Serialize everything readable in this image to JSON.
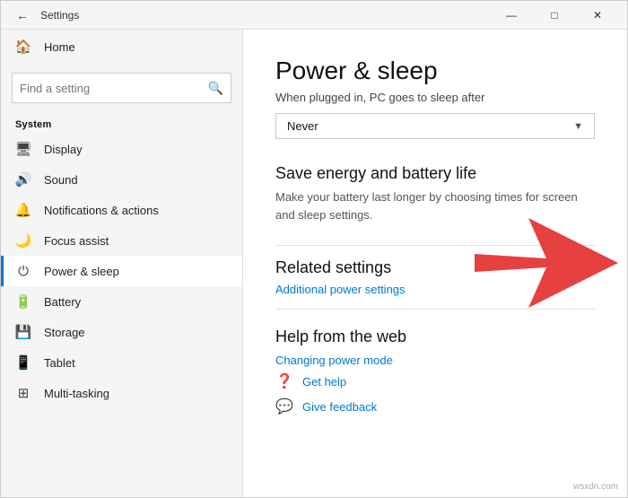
{
  "titlebar": {
    "title": "Settings",
    "back_label": "←",
    "minimize": "—",
    "maximize": "□",
    "close": "✕"
  },
  "sidebar": {
    "search_placeholder": "Find a setting",
    "home_label": "Home",
    "section_label": "System",
    "items": [
      {
        "id": "display",
        "label": "Display",
        "icon": "🖥"
      },
      {
        "id": "sound",
        "label": "Sound",
        "icon": "🔊"
      },
      {
        "id": "notifications",
        "label": "Notifications & actions",
        "icon": "🔔"
      },
      {
        "id": "focus",
        "label": "Focus assist",
        "icon": "🌙"
      },
      {
        "id": "power",
        "label": "Power & sleep",
        "icon": "⏻",
        "active": true
      },
      {
        "id": "battery",
        "label": "Battery",
        "icon": "🔋"
      },
      {
        "id": "storage",
        "label": "Storage",
        "icon": "💾"
      },
      {
        "id": "tablet",
        "label": "Tablet",
        "icon": "📱"
      },
      {
        "id": "multitasking",
        "label": "Multi-tasking",
        "icon": "⊞"
      }
    ]
  },
  "main": {
    "title": "Power & sleep",
    "sleep_label": "When plugged in, PC goes to sleep after",
    "dropdown_value": "Never",
    "save_energy_heading": "Save energy and battery life",
    "save_energy_text": "Make your battery last longer by choosing times for screen and sleep settings.",
    "related_heading": "Related settings",
    "additional_power_link": "Additional power settings",
    "help_heading": "Help from the web",
    "changing_power_link": "Changing power mode",
    "get_help_label": "Get help",
    "give_feedback_label": "Give feedback"
  },
  "watermark": "wsxdn.com"
}
